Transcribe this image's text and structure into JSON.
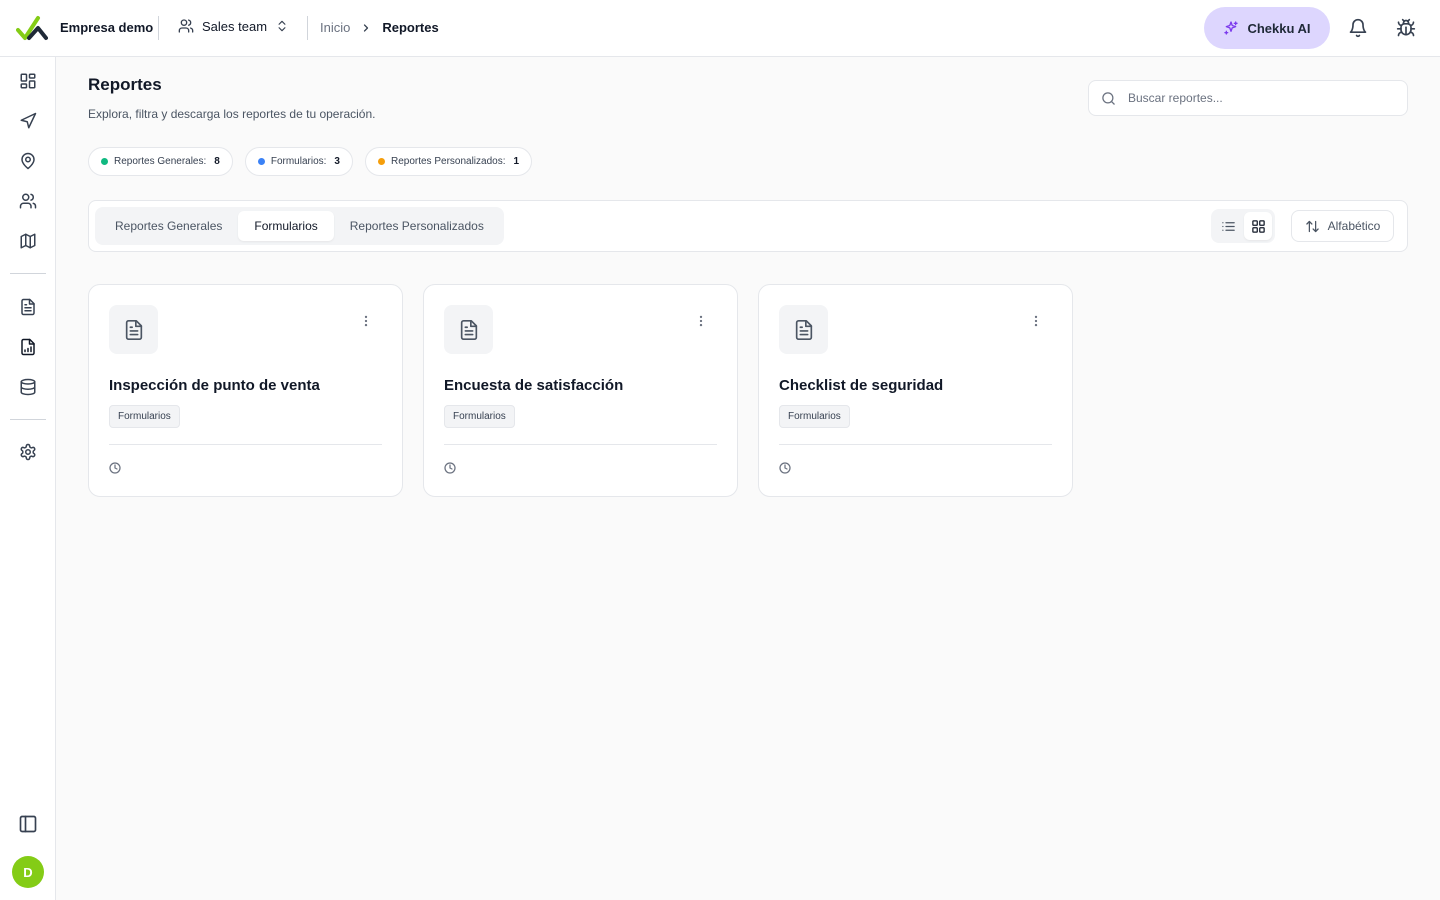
{
  "header": {
    "company": "Empresa demo",
    "team": "Sales team",
    "breadcrumb": [
      "Inicio",
      "Reportes"
    ],
    "ai_button": "Chekku AI"
  },
  "sidebar": {
    "top_items": [
      "dashboard-icon",
      "send-icon",
      "map-pin-icon",
      "users-icon",
      "map-icon"
    ],
    "mid_items": [
      "file-text-icon",
      "file-chart-icon",
      "database-icon"
    ],
    "bottom_items": [
      "settings-icon"
    ],
    "avatar_initial": "D"
  },
  "page": {
    "title": "Reportes",
    "subtitle": "Explora, filtra y descarga los reportes de tu operación.",
    "search_placeholder": "Buscar reportes..."
  },
  "summary": [
    {
      "label": "Reportes Generales:",
      "count": "8",
      "color": "#10b981"
    },
    {
      "label": "Formularios:",
      "count": "3",
      "color": "#3b82f6"
    },
    {
      "label": "Reportes Personalizados:",
      "count": "1",
      "color": "#f59e0b"
    }
  ],
  "tabs": [
    {
      "label": "Reportes Generales",
      "active": false
    },
    {
      "label": "Formularios",
      "active": true
    },
    {
      "label": "Reportes Personalizados",
      "active": false
    }
  ],
  "sort_label": "Alfabético",
  "view_mode": "grid",
  "cards": [
    {
      "title": "Inspección de punto de venta",
      "tag": "Formularios"
    },
    {
      "title": "Encuesta de satisfacción",
      "tag": "Formularios"
    },
    {
      "title": "Checklist de seguridad",
      "tag": "Formularios"
    }
  ],
  "colors": {
    "accent": "#84cc16",
    "ai_button_bg": "#ddd6fe",
    "ai_icon": "#7c3aed"
  }
}
